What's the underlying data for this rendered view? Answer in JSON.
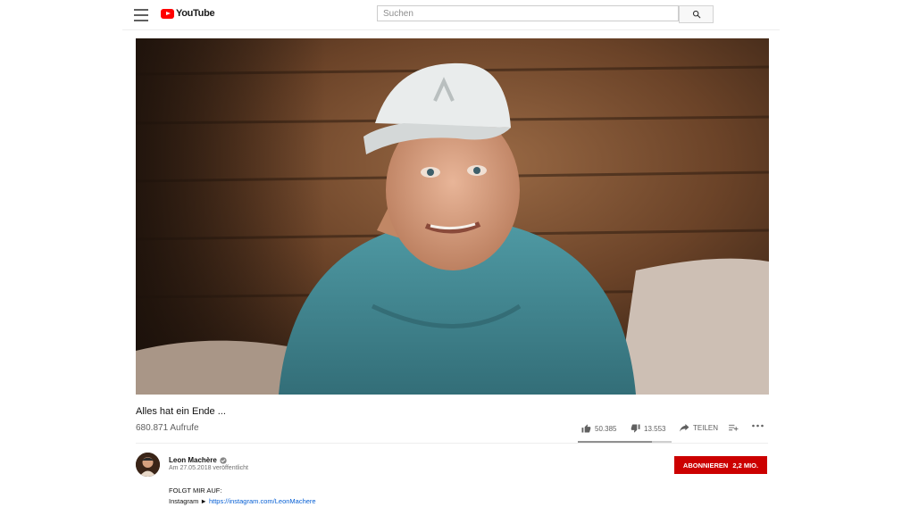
{
  "header": {
    "logo_text": "YouTube",
    "search_placeholder": "Suchen"
  },
  "video": {
    "title": "Alles hat ein Ende ...",
    "views": "680.871 Aufrufe",
    "likes": "50.385",
    "dislikes": "13.553",
    "share_label": "TEILEN",
    "like_ratio": 0.788
  },
  "channel": {
    "name": "Leon Machère",
    "published": "Am 27.05.2018 veröffentlicht",
    "subscribe_label": "ABONNIEREN",
    "subscriber_count": "2,2 MIO."
  },
  "description": {
    "line1": "FOLGT MIR AUF:",
    "line2_prefix": "Instagram ►",
    "instagram_url": "https://instagram.com/LeonMachere"
  },
  "colors": {
    "brand": "#ff0000",
    "subscribe": "#cc0000",
    "link": "#065fd4"
  },
  "icons": [
    "menu-icon",
    "youtube-play-icon",
    "search-icon",
    "thumbs-up-icon",
    "thumbs-down-icon",
    "share-icon",
    "add-to-playlist-icon",
    "more-icon",
    "verified-icon"
  ]
}
